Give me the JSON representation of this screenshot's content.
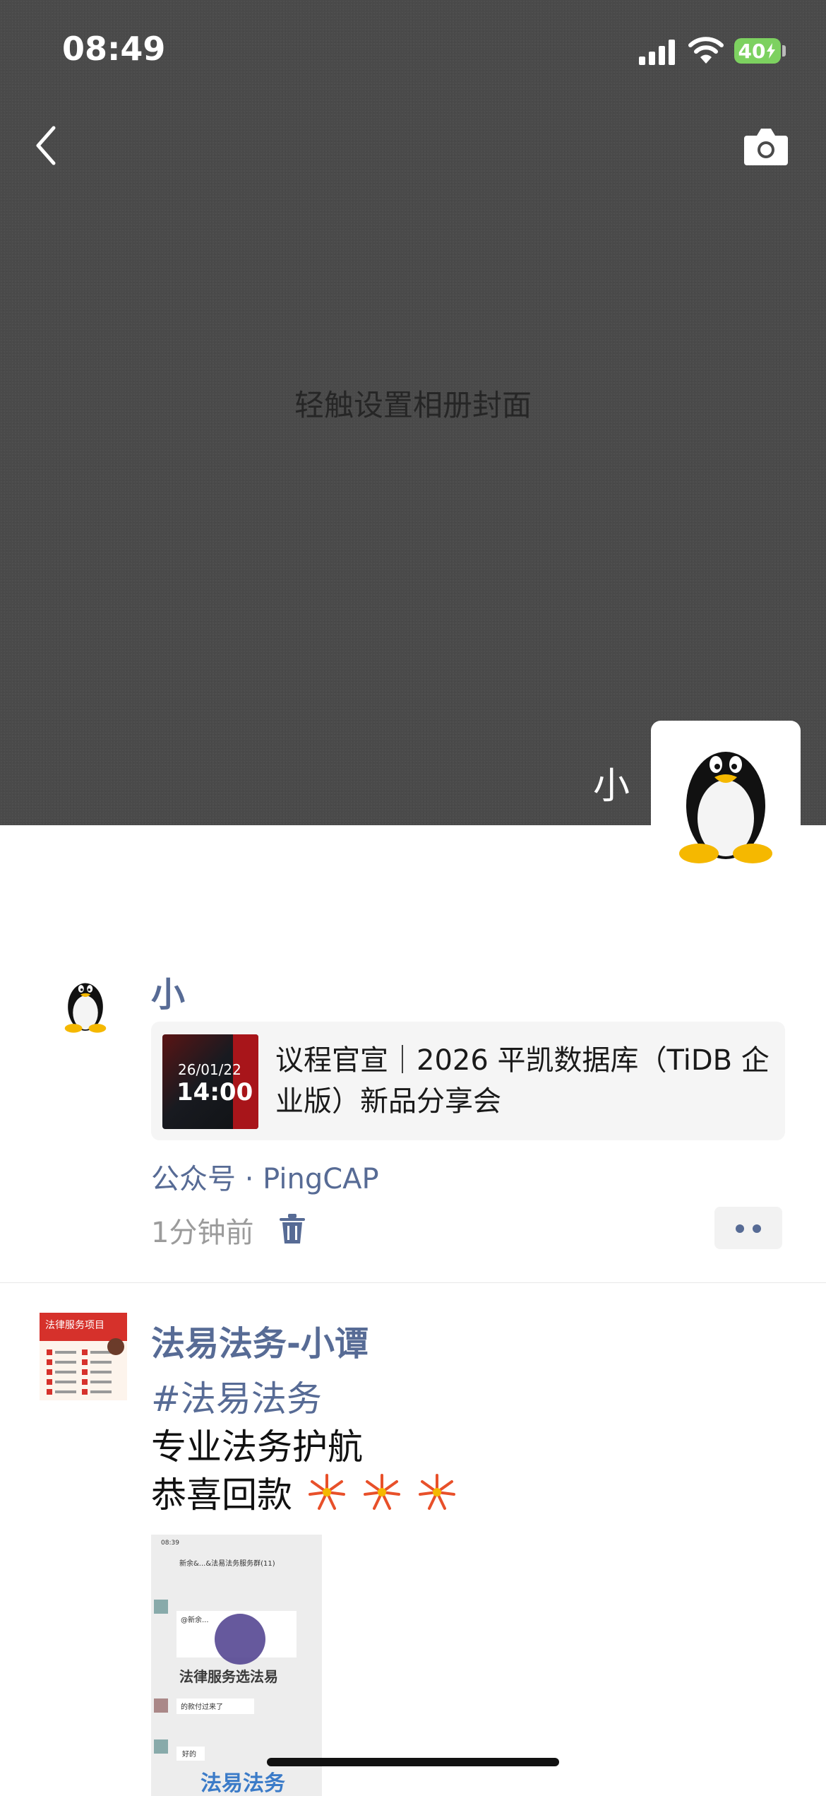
{
  "status_bar": {
    "time": "08:49",
    "battery": "40"
  },
  "cover": {
    "hint": "轻触设置相册封面",
    "profile_name": "小"
  },
  "posts": [
    {
      "author": "小",
      "share": {
        "thumb_date": "26/01/22",
        "thumb_time": "14:00",
        "title": "议程官宣｜2026 平凯数据库（TiDB 企业版）新品分享会"
      },
      "source": "公众号 · PingCAP",
      "time_ago": "1分钟前"
    },
    {
      "author": "法易法务-小谭",
      "hashtag": "#法易法务",
      "lines": [
        "专业法务护航",
        "恭喜回款"
      ],
      "avatar_text": [
        "法律服务项目"
      ],
      "image_text": {
        "status_time": "08:39",
        "chat_title": "新余&...&法易法务服务群(11)",
        "msg1": "@新余...",
        "banner": "法律服务选法易",
        "msg2": "的款付过来了",
        "msg3": "好的",
        "brand": "法易法务"
      }
    }
  ],
  "colors": {
    "link": "#576b95",
    "cover": "#4a4a4a"
  }
}
